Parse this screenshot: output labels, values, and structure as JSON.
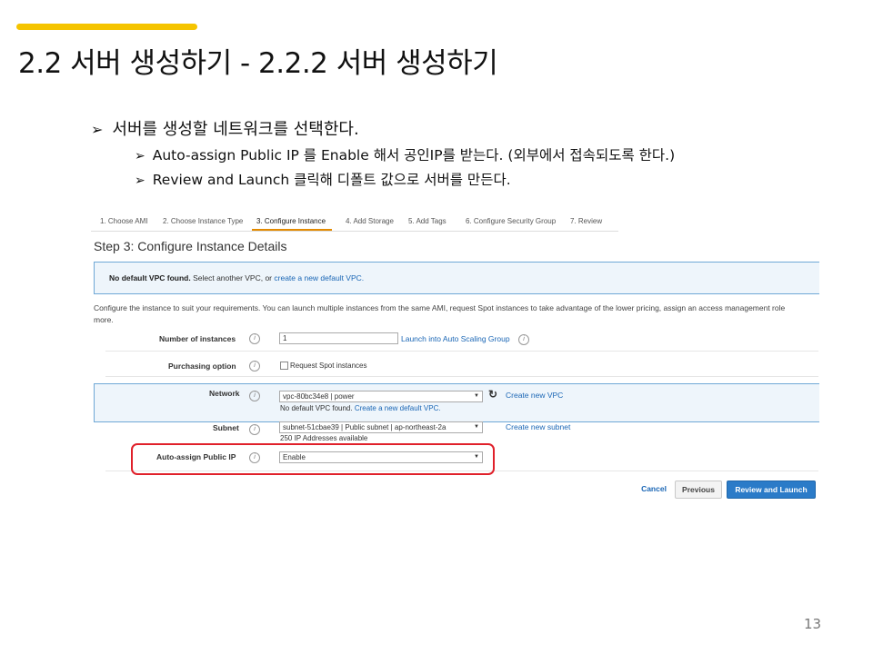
{
  "slide": {
    "title": "2.2 서버 생성하기 - 2.2.2 서버 생성하기",
    "bullets": {
      "main": "서버를 생성할 네트워크를 선택한다.",
      "sub1": "Auto-assign Public IP 를 Enable 해서 공인IP를 받는다. (외부에서 접속되도록 한다.)",
      "sub2": "Review and Launch 클릭해 디폴트 값으로 서버를 만든다."
    },
    "arrow_glyph": "➢",
    "page_number": "13",
    "accent_color": "#f5c400",
    "highlight_color": "#e0202a"
  },
  "screenshot": {
    "steps": [
      "1. Choose AMI",
      "2. Choose Instance Type",
      "3. Configure Instance",
      "4. Add Storage",
      "5. Add Tags",
      "6. Configure Security Group",
      "7. Review"
    ],
    "active_step": 2,
    "page_title": "Step 3: Configure Instance Details",
    "alert": {
      "bold": "No default VPC found.",
      "text": " Select another VPC, or ",
      "link": "create a new default VPC."
    },
    "description": "Configure the instance to suit your requirements. You can launch multiple instances from the same AMI, request Spot instances to take advantage of the lower pricing, assign an access management role to the instance, and more.",
    "description_visible_line1": "Configure the instance to suit your requirements. You can launch multiple instances from the same AMI, request Spot instances to take advantage of the lower pricing, assign an access management role",
    "description_visible_line2": "more.",
    "fields": {
      "instances_label": "Number of instances",
      "instances_value": "1",
      "asg_link": "Launch into Auto Scaling Group",
      "purchasing_label": "Purchasing option",
      "spot_label": "Request Spot instances",
      "network_label": "Network",
      "network_value": "vpc-80bc34e8 | power",
      "network_note": "No default VPC found.",
      "network_note_link": "Create a new default VPC.",
      "create_vpc": "Create new VPC",
      "subnet_label": "Subnet",
      "subnet_value": "subnet-51cbae39 | Public subnet | ap-northeast-2a",
      "subnet_note": "250 IP Addresses available",
      "create_subnet": "Create new subnet",
      "public_ip_label": "Auto-assign Public IP",
      "public_ip_value": "Enable"
    },
    "buttons": {
      "cancel": "Cancel",
      "previous": "Previous",
      "review": "Review and Launch"
    },
    "icons": {
      "info": "info-icon",
      "refresh": "refresh-icon",
      "dropdown": "chevron-down-icon"
    }
  }
}
